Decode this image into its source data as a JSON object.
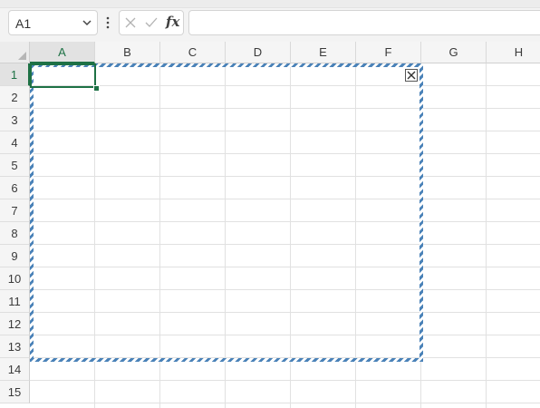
{
  "formula_bar": {
    "name_box_value": "A1",
    "formula_value": "",
    "name_box_icon": "chevron-down-icon",
    "more_icon": "vertical-ellipsis-icon",
    "cancel_icon": "cancel-x-icon",
    "enter_icon": "checkmark-icon",
    "fx_label": "fx"
  },
  "grid": {
    "columns": [
      "A",
      "B",
      "C",
      "D",
      "E",
      "F",
      "G",
      "H"
    ],
    "rows": [
      "1",
      "2",
      "3",
      "4",
      "5",
      "6",
      "7",
      "8",
      "9",
      "10",
      "11",
      "12",
      "13",
      "14",
      "15"
    ],
    "active_cell": "A1",
    "active_column": "A",
    "active_row": "1"
  },
  "overlay": {
    "close_icon": "close-x-icon"
  },
  "colors": {
    "accent": "#1e7145",
    "frame_stripe": "#4a82b8"
  }
}
